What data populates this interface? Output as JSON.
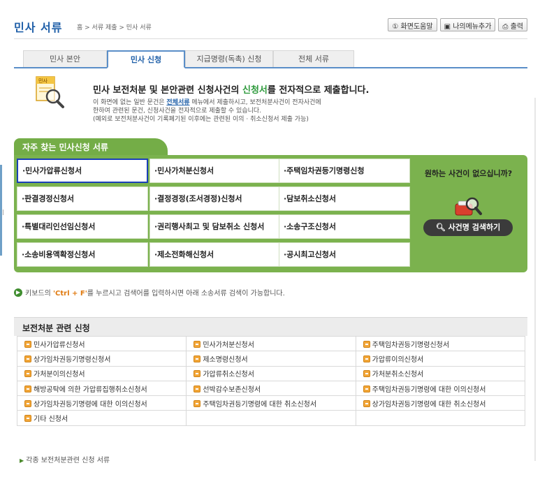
{
  "header": {
    "title": "민사 서류",
    "breadcrumb": "홈 > 서류 제출 > 민사 서류",
    "buttons": {
      "help": "① 화면도움말",
      "mymenu": "나의메뉴추가",
      "print": "출력"
    }
  },
  "tabs": [
    {
      "label": "민사 본안"
    },
    {
      "label": "민사 신청"
    },
    {
      "label": "지급명령(독촉) 신청"
    },
    {
      "label": "전체 서류"
    }
  ],
  "intro": {
    "icon_label": "민사",
    "heading_before": "민사 보전처분 및 본안관련 신청사건의 ",
    "heading_highlight": "신청서",
    "heading_after": "를 전자적으로 제출합니다.",
    "line1_before": "이 화면에 없는 일반 문건은 ",
    "line1_link": "전체서류",
    "line1_after": " 메뉴에서 제출하시고, 보전처분사건이 전자사건에",
    "line2": "한하여 관련된 문건, 신청사건을 전자적으로 제출할 수 있습니다.",
    "line3": "(예외로 보전처분사건이 기록폐기된 이후에는 관련된 이의 · 취소신청서 제출 가능)"
  },
  "frequent": {
    "title": "자주 찾는 민사신청 서류",
    "items": [
      "·민사가압류신청서",
      "·민사가처분신청서",
      "·주택임차권등기명령신청",
      "·판결경정신청서",
      "·결정경정(조서경정)신청서",
      "·담보취소신청서",
      "·특별대리인선임신청서",
      "·권리행사최고 및 담보취소 신청서",
      "·소송구조신청서",
      "·소송비용액확정신청서",
      "·제소전화해신청서",
      "·공시최고신청서"
    ],
    "side_question": "원하는 사건이 없으십니까?",
    "search_button": "사건명 검색하기"
  },
  "tip": {
    "before": "키보드의 ",
    "key": "'Ctrl + F'",
    "after": "를 누르시고 검색어를 입력하시면 아래 소송서류 검색이 가능합니다."
  },
  "section": {
    "title": "보전처분 관련 신청",
    "rows": [
      [
        "민사가압류신청서",
        "민사가처분신청서",
        "주택임차권등기명령신청서"
      ],
      [
        "상가임차권등기명령신청서",
        "제소명령신청서",
        "가압류이의신청서"
      ],
      [
        "가처분이의신청서",
        "가압류취소신청서",
        "가처분취소신청서"
      ],
      [
        "해방공탁에 의한 가압류집행취소신청서",
        "선박감수보존신청서",
        "주택임차권등기명령에 대한 이의신청서"
      ],
      [
        "상가임차권등기명령에 대한 이의신청서",
        "주택임차권등기명령에 대한 취소신청서",
        "상가임차권등기명령에 대한 취소신청서"
      ],
      [
        "기타 신청서",
        "",
        ""
      ]
    ]
  },
  "footer": {
    "link": "각종 보전처분관련 신청 서류"
  },
  "colors": {
    "accent_blue": "#1f5fa8",
    "panel_green": "#7bb24e",
    "highlight_green": "#2e9a3c",
    "key_orange": "#e07a10"
  }
}
